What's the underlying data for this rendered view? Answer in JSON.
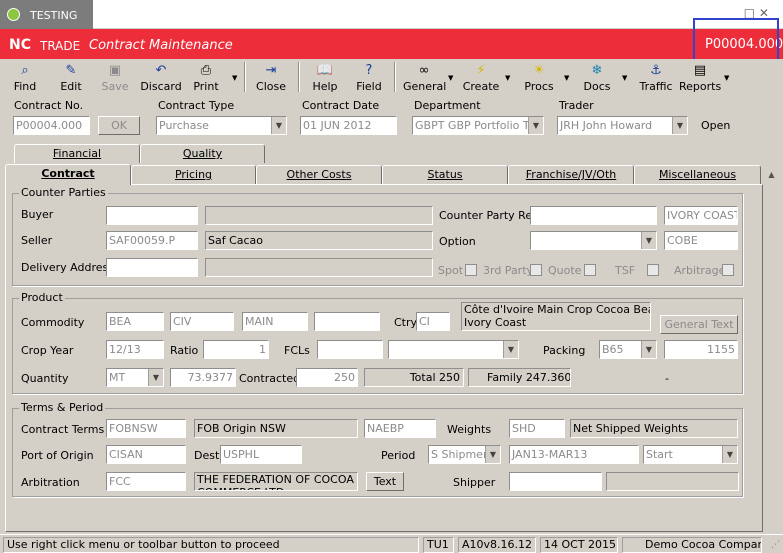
{
  "window": {
    "title": "TESTING",
    "controls": "_  □  ✕"
  },
  "header": {
    "brand": "NC",
    "module": "TRADE",
    "title": "Contract Maintenance",
    "contract_no": "P00004.000"
  },
  "toolbar": {
    "items": [
      {
        "label": "Find",
        "icon": "find-icon"
      },
      {
        "label": "Edit",
        "icon": "edit-icon"
      },
      {
        "label": "Save",
        "icon": "save-icon",
        "disabled": true
      },
      {
        "label": "Discard",
        "icon": "discard-icon"
      },
      {
        "label": "Print",
        "icon": "printer-icon"
      },
      {
        "label": "Close",
        "icon": "close-door-icon"
      },
      {
        "label": "Help",
        "icon": "help-book-icon"
      },
      {
        "label": "Field",
        "icon": "field-help-icon"
      },
      {
        "label": "General",
        "icon": "general-icon"
      },
      {
        "label": "Create",
        "icon": "create-icon"
      },
      {
        "label": "Procs",
        "icon": "procs-icon"
      },
      {
        "label": "Docs",
        "icon": "docs-icon"
      },
      {
        "label": "Traffic",
        "icon": "traffic-icon"
      },
      {
        "label": "Reports",
        "icon": "reports-icon"
      }
    ]
  },
  "top": {
    "contract_no_label": "Contract No.",
    "contract_no": "P00004.000",
    "ok": "OK",
    "contract_type_label": "Contract Type",
    "contract_type": "Purchase",
    "contract_date_label": "Contract Date",
    "contract_date": "01 JUN 2012",
    "department_label": "Department",
    "department": "GBPT GBP Portfolio Tra",
    "trader_label": "Trader",
    "trader": "JRH John Howard",
    "status": "Open"
  },
  "tabs_back": [
    "Financial",
    "Quality"
  ],
  "tabs": [
    "Contract",
    "Pricing",
    "Other Costs",
    "Status",
    "Franchise/JV/Oth",
    "Miscellaneous"
  ],
  "counter_parties": {
    "title": "Counter Parties",
    "buyer_label": "Buyer",
    "buyer": "",
    "buyer_name": "",
    "cp_ref_label": "Counter Party Ref.",
    "cp_ref": "",
    "cp_ref2": "IVORY COAST",
    "seller_label": "Seller",
    "seller": "SAF00059.P",
    "seller_name": "Saf Cacao",
    "option_label": "Option",
    "option": "",
    "option2": "COBE",
    "delivery_label": "Delivery Address",
    "delivery": "",
    "delivery_name": "",
    "spot": "Spot",
    "third_party": "3rd Party",
    "quote": "Quote",
    "tsf": "TSF",
    "arbitrage": "Arbitrage"
  },
  "product": {
    "title": "Product",
    "commodity_label": "Commodity",
    "c1": "BEA",
    "c2": "CIV",
    "c3": "MAIN",
    "c4": "",
    "ctry_label": "Ctry",
    "ctry": "CI",
    "desc1": "Côte d'Ivoire Main Crop Cocoa Beans",
    "desc2": "Ivory Coast",
    "general_text": "General Text",
    "crop_year_label": "Crop Year",
    "crop_year": "12/13",
    "ratio_label": "Ratio",
    "ratio": "1",
    "fcls_label": "FCLs",
    "fcls": "",
    "fcls_sel": "",
    "packing_label": "Packing",
    "packing": "B65",
    "packing_qty": "1155",
    "quantity_label": "Quantity",
    "unit": "MT",
    "quantity": "73.9377",
    "contracted_label": "Contracted",
    "contracted": "250",
    "total": "Total 250",
    "family": "Family 247.3604",
    "dash": "-"
  },
  "terms": {
    "title": "Terms & Period",
    "terms_label": "Contract Terms",
    "terms_code": "FOBNSW",
    "terms_name": "FOB Origin NSW",
    "naebp": "NAEBP",
    "weights_label": "Weights",
    "weights_code": "SHD",
    "weights_name": "Net Shipped Weights",
    "port_label": "Port of Origin",
    "port": "CISAN",
    "dest_label": "Dest.",
    "dest": "USPHL",
    "period_label": "Period",
    "period_type": "S Shipment",
    "period": "JAN13-MAR13",
    "period_start": "Start",
    "arb_label": "Arbitration",
    "arb": "FCC",
    "arb_name": "THE FEDERATION OF COCOA COMMERCE LTD",
    "text_btn": "Text",
    "shipper_label": "Shipper",
    "shipper": "",
    "shipper_name": ""
  },
  "status": {
    "hint": "Use right click menu or toolbar button to proceed",
    "user": "TU1",
    "version": "A10v8.16.12",
    "date": "14 OCT 2015",
    "company": "Demo Cocoa Company"
  }
}
